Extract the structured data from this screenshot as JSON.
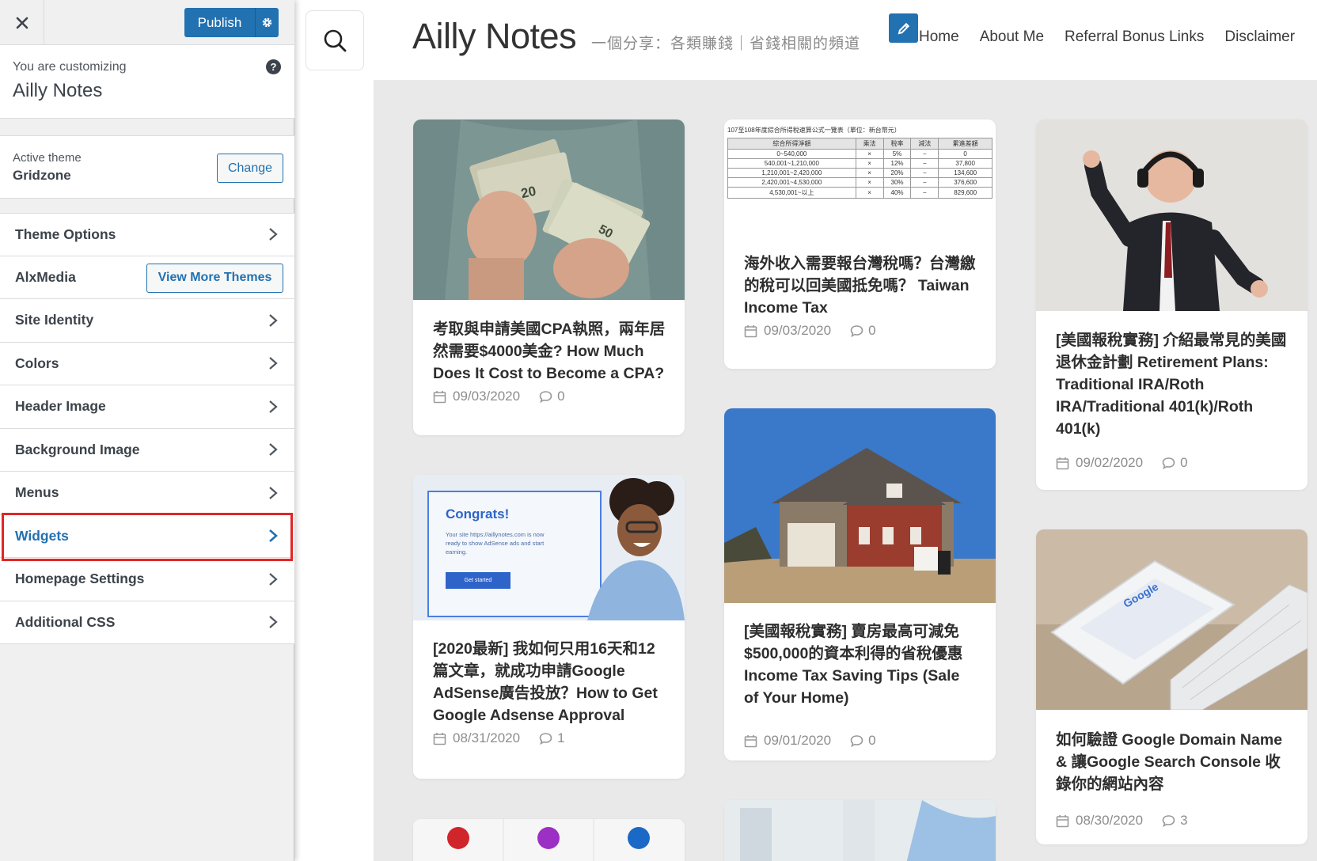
{
  "sidebar": {
    "close_label": "×",
    "publish_label": "Publish",
    "customizing_label": "You are customizing",
    "site_name": "Ailly Notes",
    "help_label": "?",
    "active_theme_label": "Active theme",
    "active_theme_name": "Gridzone",
    "change_label": "Change",
    "items": [
      {
        "label": "Theme Options"
      },
      {
        "label": "AlxMedia",
        "button": "View More Themes"
      },
      {
        "label": "Site Identity"
      },
      {
        "label": "Colors"
      },
      {
        "label": "Header Image"
      },
      {
        "label": "Background Image"
      },
      {
        "label": "Menus"
      },
      {
        "label": "Widgets",
        "highlighted": true
      },
      {
        "label": "Homepage Settings"
      },
      {
        "label": "Additional CSS"
      }
    ]
  },
  "preview": {
    "site_title": "Ailly Notes",
    "tagline": "一個分享：各類賺錢｜省錢相關的頻道",
    "nav": [
      "Home",
      "About Me",
      "Referral Bonus Links",
      "Disclaimer"
    ],
    "posts": [
      {
        "title": "考取與申請美國CPA執照，兩年居然需要$4000美金? How Much Does It Cost to Become a CPA?",
        "date": "09/03/2020",
        "comments": "0"
      },
      {
        "title": "海外收入需要報台灣稅嗎？台灣繳的稅可以回美國抵免嗎？ Taiwan Income Tax",
        "date": "09/03/2020",
        "comments": "0"
      },
      {
        "title": "[美國報稅實務] 介紹最常見的美國退休金計劃 Retirement Plans: Traditional IRA/Roth IRA/Traditional 401(k)/Roth 401(k)",
        "date": "09/02/2020",
        "comments": "0"
      },
      {
        "title": "[2020最新] 我如何只用16天和12篇文章，就成功申請Google AdSense廣告投放？How to Get Google Adsense Approval",
        "date": "08/31/2020",
        "comments": "1"
      },
      {
        "title": "[美國報稅實務] 賣房最高可減免$500,000的資本利得的省稅優惠 Income Tax Saving Tips (Sale of Your Home)",
        "date": "09/01/2020",
        "comments": "0"
      },
      {
        "title": "如何驗證 Google Domain Name & 讓Google Search Console 收錄你的網站內容",
        "date": "08/30/2020",
        "comments": "3"
      }
    ],
    "tax_table": {
      "caption": "107至108年度綜合所得稅速算公式一覽表（單位：新台幣元）",
      "headers": [
        "綜合所得淨額",
        "乘法",
        "稅率",
        "減法",
        "累進差額"
      ],
      "rows": [
        [
          "0~540,000",
          "×",
          "5%",
          "−",
          "0"
        ],
        [
          "540,001~1,210,000",
          "×",
          "12%",
          "−",
          "37,800"
        ],
        [
          "1,210,001~2,420,000",
          "×",
          "20%",
          "−",
          "134,600"
        ],
        [
          "2,420,001~4,530,000",
          "×",
          "30%",
          "−",
          "376,600"
        ],
        [
          "4,530,001~以上",
          "×",
          "40%",
          "−",
          "829,600"
        ]
      ]
    },
    "adsense_mock": {
      "heading": "Congrats!",
      "body": "Your site https://aillynotes.com is now ready to show AdSense ads and start earning.",
      "button": "Get started"
    }
  },
  "colors": {
    "accent": "#2271b1",
    "highlight": "#e02626"
  }
}
